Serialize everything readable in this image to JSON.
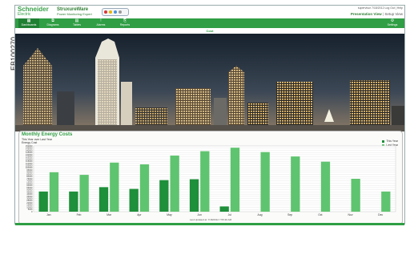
{
  "side_code": "EB100270",
  "header": {
    "brand": "Schneider",
    "brand_sub": "Electric",
    "product": "StruxureWare",
    "product_tag": "Power Monitoring Expert",
    "user_info": "supervisor 7/18/2012 Log Out | Help",
    "view_presentation": "Presentation View",
    "view_setup": "Setup View"
  },
  "nav": [
    {
      "label": "Dashboards",
      "icon": "dashboard-icon",
      "glyph": "▦",
      "active": true
    },
    {
      "label": "Diagrams",
      "icon": "diagram-icon",
      "glyph": "⧉",
      "active": false
    },
    {
      "label": "Tables",
      "icon": "table-icon",
      "glyph": "▤",
      "active": false
    },
    {
      "label": "Alarms",
      "icon": "alarm-icon",
      "glyph": "!",
      "active": false
    },
    {
      "label": "Reports",
      "icon": "report-icon",
      "glyph": "⎘",
      "active": false
    }
  ],
  "settings_label": "Settings",
  "settings_icon": "wrench-icon",
  "breadcrumb": "Cost",
  "panel": {
    "title": "Monthly Energy Costs",
    "subtitle": "This Year over Last Year",
    "subtitle2": "Energy Cost",
    "updated": "Last Updated at: 7/18/2012 7:55:30 AM"
  },
  "chart_data": {
    "type": "bar",
    "categories": [
      "Jan",
      "Feb",
      "Mar",
      "Apr",
      "May",
      "Jun",
      "Jul",
      "Aug",
      "Sep",
      "Oct",
      "Nov",
      "Dec"
    ],
    "ylim": [
      0,
      150000
    ],
    "yticks": [
      "0",
      "5000",
      "10000",
      "15000",
      "20000",
      "25000",
      "30000",
      "35000",
      "40000",
      "45000",
      "50000",
      "55000",
      "60000",
      "65000",
      "70000",
      "75000",
      "80000",
      "85000",
      "90000",
      "95000",
      "100000",
      "105000",
      "110000",
      "115000",
      "120000",
      "125000",
      "130000",
      "135000",
      "140000",
      "145000",
      "150000"
    ],
    "series": [
      {
        "name": "This Year",
        "color": "#1e8f3a",
        "values": [
          46000,
          46000,
          56000,
          52000,
          72000,
          74000,
          12000,
          null,
          null,
          null,
          null,
          null
        ]
      },
      {
        "name": "Last Year",
        "color": "#5fc46f",
        "values": [
          90000,
          84000,
          112000,
          108000,
          128000,
          138000,
          146000,
          136000,
          126000,
          114000,
          75000,
          46000
        ]
      }
    ],
    "legend_position": "top-right",
    "grid": true
  }
}
